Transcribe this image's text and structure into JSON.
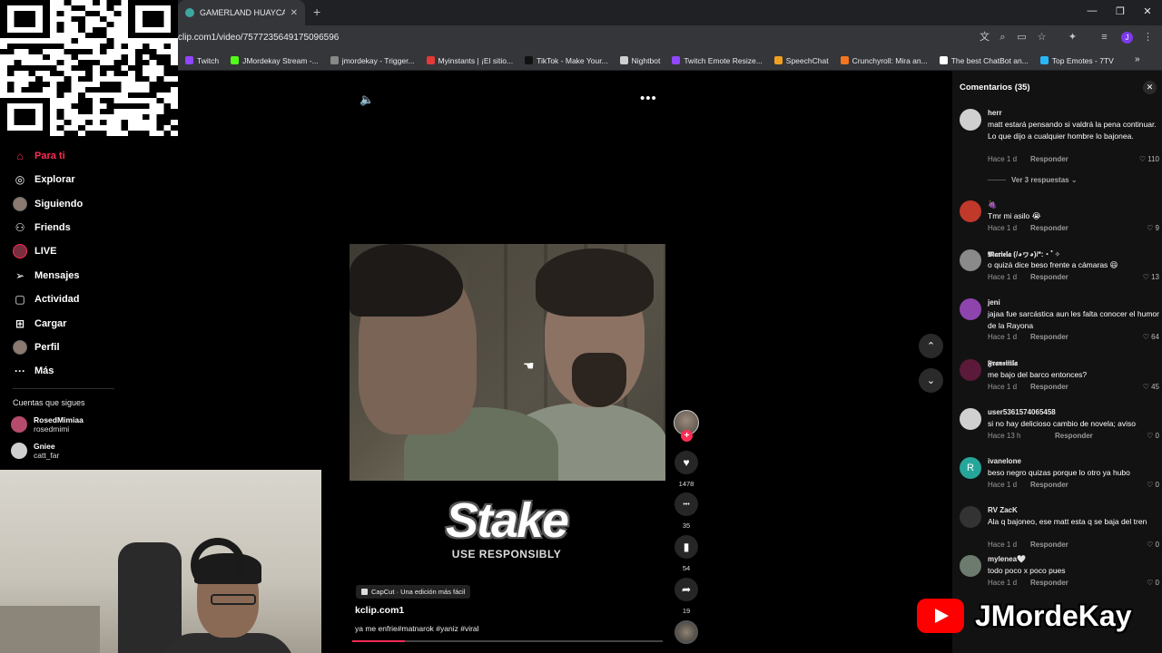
{
  "browser": {
    "tab_title": "GAMERLAND HUAYCAN - Goog",
    "new_tab": "+",
    "url": "clip.com1/video/7577235649175096596",
    "window_controls": [
      "—",
      "❐",
      "✕"
    ],
    "bookmarks": [
      {
        "label": "Twitch",
        "color": "#9146ff"
      },
      {
        "label": "JMordekay Stream -...",
        "color": "#53fc18"
      },
      {
        "label": "jmordekay - Trigger...",
        "color": "#888888"
      },
      {
        "label": "Myinstants | ¡El sitio...",
        "color": "#e53935"
      },
      {
        "label": "TikTok - Make Your...",
        "color": "#111111"
      },
      {
        "label": "Nightbot",
        "color": "#cfcfcf"
      },
      {
        "label": "Twitch Emote Resize...",
        "color": "#9146ff"
      },
      {
        "label": "SpeechChat",
        "color": "#f0a020"
      },
      {
        "label": "Crunchyroll: Mira an...",
        "color": "#f47521"
      },
      {
        "label": "The best ChatBot an...",
        "color": "#ffffff"
      },
      {
        "label": "Top Emotes - 7TV",
        "color": "#29b6f6"
      }
    ],
    "profile_initial": "J"
  },
  "sidebar": {
    "nav": [
      {
        "label": "Para ti",
        "icon": "home-icon",
        "glyph": "⌂",
        "active": true
      },
      {
        "label": "Explorar",
        "icon": "compass-icon",
        "glyph": "◎",
        "active": false
      },
      {
        "label": "Siguiendo",
        "icon": "following-avatar-icon",
        "glyph": "●",
        "active": false
      },
      {
        "label": "Friends",
        "icon": "friends-icon",
        "glyph": "⚇",
        "active": false
      },
      {
        "label": "LIVE",
        "icon": "live-icon",
        "glyph": "●",
        "active": false
      },
      {
        "label": "Mensajes",
        "icon": "send-icon",
        "glyph": "➢",
        "active": false
      },
      {
        "label": "Actividad",
        "icon": "activity-icon",
        "glyph": "▢",
        "active": false
      },
      {
        "label": "Cargar",
        "icon": "upload-icon",
        "glyph": "⊞",
        "active": false
      },
      {
        "label": "Perfil",
        "icon": "profile-icon",
        "glyph": "●",
        "active": false
      },
      {
        "label": "Más",
        "icon": "more-icon",
        "glyph": "···",
        "active": false
      }
    ],
    "following_title": "Cuentas que sigues",
    "accounts": [
      {
        "name": "RosedMimiaa",
        "handle": "rosedmimi"
      },
      {
        "name": "Gniee",
        "handle": "catt_far"
      }
    ]
  },
  "video": {
    "sponsor_logo": "Stake",
    "sponsor_tagline": "USE RESPONSIBLY",
    "capcut_label": "CapCut · Una edición más fácil",
    "author": "kclip.com1",
    "description": "ya me enfrie#matnarok #yaniz #viral",
    "progress": 0.17,
    "follow_plus": "+",
    "actions": [
      {
        "name": "like",
        "icon": "heart-icon",
        "glyph": "♥",
        "count": "1478"
      },
      {
        "name": "comment",
        "icon": "comment-icon",
        "glyph": "•••",
        "count": "35"
      },
      {
        "name": "save",
        "icon": "bookmark-icon",
        "glyph": "▮",
        "count": "54"
      },
      {
        "name": "share",
        "icon": "share-icon",
        "glyph": "➦",
        "count": "19"
      }
    ]
  },
  "comments": {
    "title": "Comentarios (35)",
    "replies_link": "Ver 3 respuestas",
    "reply_label": "Responder",
    "items": [
      {
        "user": "herr",
        "text": "matt estará pensando si valdrá la pena continuar. Lo que dijo a cualquier hombre lo bajonea.",
        "time": "Hace 1 d",
        "likes": "110",
        "avatar": "#d0d0d0"
      },
      {
        "user": "🍇",
        "text": "Tmr mi asilo 😭",
        "time": "Hace 1 d",
        "likes": "9",
        "avatar": "#c0392b"
      },
      {
        "user": "𝕸𝖆𝖗𝖎𝖊𝖑𝖆 (/◕ヮ◕)/*:・ﾟ✧",
        "text": "o quizá dice beso frente a cámaras 😆",
        "time": "Hace 1 d",
        "likes": "13",
        "avatar": "#8a8a8a"
      },
      {
        "user": "jeni",
        "text": "jajaa fue sarcástica aun les falta conocer el humor de la Rayona",
        "time": "Hace 1 d",
        "likes": "64",
        "avatar": "#8e44ad"
      },
      {
        "user": "𝕱𝖗𝖆𝖓𝖘𝖎𝖎𝖎𝖑𝖆",
        "text": "me bajo del barco entonces?",
        "time": "Hace 1 d",
        "likes": "45",
        "avatar": "#5b1a3a"
      },
      {
        "user": "user5361574065458",
        "text": "si no hay delicioso cambio de novela; aviso",
        "time": "Hace 13 h",
        "likes": "0",
        "avatar": "#d0d0d0"
      },
      {
        "user": "ivanelone",
        "text": "beso negro quizas porque lo otro ya hubo",
        "time": "Hace 1 d",
        "likes": "0",
        "avatar": "#26a69a",
        "initial": "R"
      },
      {
        "user": "RV ZacK",
        "text": "Ala q bajoneo, ese matt esta q se baja del tren",
        "time": "Hace 1 d",
        "likes": "0",
        "avatar": "#333333"
      },
      {
        "user": "mylenea🤍",
        "text": "todo poco x poco pues",
        "time": "Hace 1 d",
        "likes": "0",
        "avatar": "#6d7b6f"
      }
    ]
  },
  "overlay": {
    "channel_name": "JMordeKay"
  },
  "colors": {
    "accent": "#fe2c55",
    "panel": "#121212",
    "chrome": "#35363a"
  }
}
